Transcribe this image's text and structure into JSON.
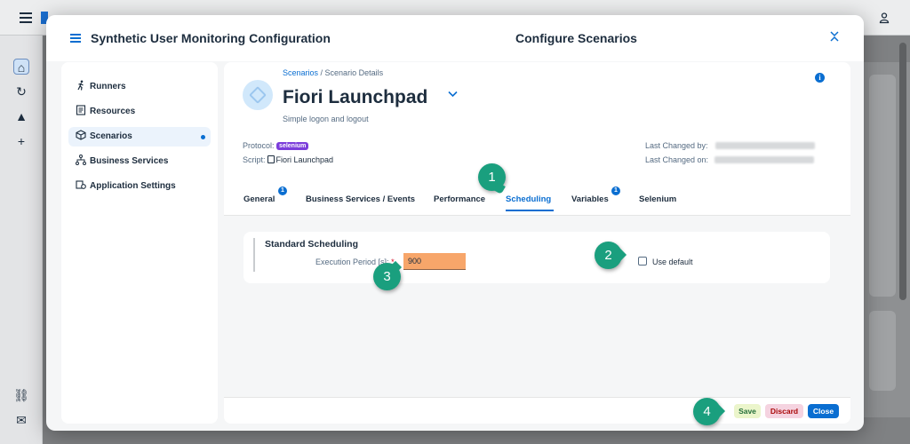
{
  "modal": {
    "app_title": "Synthetic User Monitoring Configuration",
    "center_title": "Configure Scenarios"
  },
  "nav": {
    "items": [
      {
        "label": "Runners",
        "icon": "running-icon"
      },
      {
        "label": "Resources",
        "icon": "resources-icon"
      },
      {
        "label": "Scenarios",
        "icon": "cube-icon",
        "active": true
      },
      {
        "label": "Business Services",
        "icon": "hierarchy-icon"
      },
      {
        "label": "Application Settings",
        "icon": "settings-icon"
      }
    ]
  },
  "header": {
    "breadcrumb_link": "Scenarios",
    "breadcrumb_separator": " / ",
    "breadcrumb_current": "Scenario Details",
    "title": "Fiori Launchpad",
    "subtitle": "Simple logon and logout",
    "protocol_label": "Protocol:",
    "protocol_value": "selenium",
    "script_label": "Script:",
    "script_value": "Fiori Launchpad",
    "changed_by_label": "Last Changed by:",
    "changed_on_label": "Last Changed on:"
  },
  "tabs": [
    {
      "label": "General",
      "badge": "1"
    },
    {
      "label": "Business Services / Events"
    },
    {
      "label": "Performance"
    },
    {
      "label": "Scheduling",
      "active": true
    },
    {
      "label": "Variables",
      "badge": "1"
    },
    {
      "label": "Selenium"
    }
  ],
  "scheduling": {
    "section_title": "Standard Scheduling",
    "field_label": "Execution Period [s]:",
    "required_mark": "*",
    "value": "900",
    "checkbox_label": "Use default"
  },
  "footer": {
    "save": "Save",
    "discard": "Discard",
    "close": "Close"
  },
  "markers": [
    "1",
    "2",
    "3",
    "4"
  ],
  "colors": {
    "accent": "#0a6ed1",
    "marker": "#1a9f7e",
    "input_highlight": "#f7a66a",
    "protocol_badge": "#7b3ddb"
  }
}
